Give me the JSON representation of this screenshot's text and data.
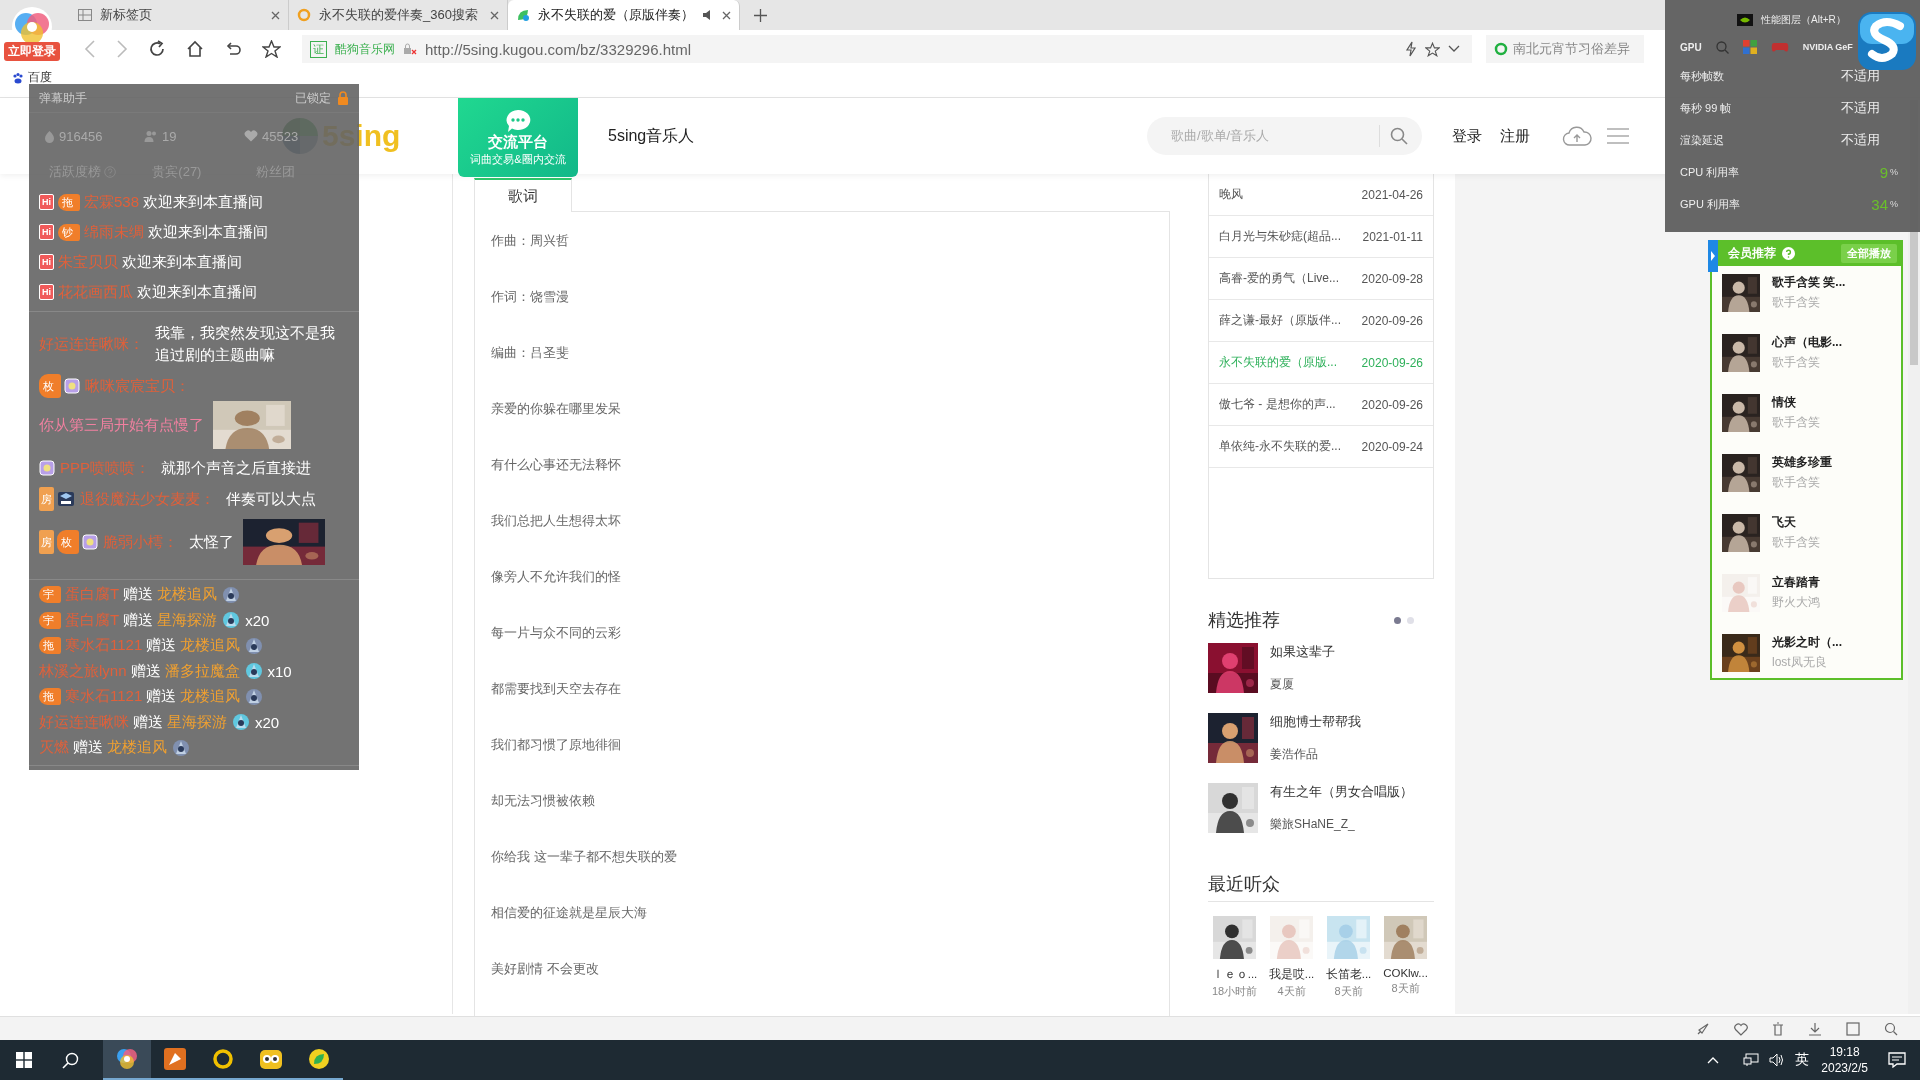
{
  "browser": {
    "tabs": [
      {
        "title": "新标签页",
        "selected": false
      },
      {
        "title": "永不失联的爱伴奏_360搜索",
        "selected": false
      },
      {
        "title": "永不失联的爱（原版伴奏）",
        "selected": true
      }
    ],
    "login_badge": "立即登录",
    "address": {
      "cert": "证",
      "site": "酷狗音乐网",
      "url": "http://5sing.kugou.com/bz/3329296.html"
    },
    "side_search": "南北元宵节习俗差异",
    "bookmarks": [
      "百度"
    ]
  },
  "header": {
    "logo": "5sing",
    "promo_title": "交流平台",
    "promo_sub": "词曲交易&圈内交流",
    "site_name": "5sing音乐人",
    "search_placeholder": "歌曲/歌单/音乐人",
    "links": [
      "登录",
      "注册"
    ]
  },
  "lyrics": {
    "tab": "歌词",
    "lines": [
      "作曲：周兴哲",
      "作词：饶雪漫",
      "编曲：吕圣斐",
      "亲爱的你躲在哪里发呆",
      "有什么心事还无法释怀",
      "我们总把人生想得太坏",
      "像旁人不允许我们的怪",
      "每一片与众不同的云彩",
      "都需要找到天空去存在",
      "我们都习惯了原地徘徊",
      "却无法习惯被依赖",
      "你给我 这一辈子都不想失联的爱",
      "相信爱的征途就是星辰大海",
      "美好剧情 不会更改"
    ]
  },
  "song_list": [
    {
      "title": "晚风",
      "date": "2021-04-26",
      "selected": false
    },
    {
      "title": "白月光与朱砂痣(超品...",
      "date": "2021-01-11",
      "selected": false
    },
    {
      "title": "高睿-爱的勇气（Live...",
      "date": "2020-09-28",
      "selected": false
    },
    {
      "title": "薛之谦-最好（原版伴...",
      "date": "2020-09-26",
      "selected": false
    },
    {
      "title": "永不失联的爱（原版...",
      "date": "2020-09-26",
      "selected": true
    },
    {
      "title": "傲七爷 - 是想你的声...",
      "date": "2020-09-26",
      "selected": false
    },
    {
      "title": "单依纯-永不失联的爱...",
      "date": "2020-09-24",
      "selected": false
    }
  ],
  "featured": {
    "title": "精选推荐",
    "pages": [
      {
        "selected": true
      },
      {
        "selected": false
      }
    ],
    "items": [
      {
        "title": "如果这辈子",
        "author": "夏厦"
      },
      {
        "title": "细胞博士帮帮我",
        "author": "姜浩作品"
      },
      {
        "title": "有生之年（男女合唱版）",
        "author": "樂旅SHaNE_Z_"
      }
    ]
  },
  "listeners": {
    "title": "最近听众",
    "items": [
      {
        "name": "ｌｅｏ...",
        "time": "18小时前"
      },
      {
        "name": "我是哎...",
        "time": "4天前"
      },
      {
        "name": "长笛老...",
        "time": "8天前"
      },
      {
        "name": "COKlw...",
        "time": "8天前"
      }
    ]
  },
  "chat_overlay": {
    "title": "弹幕助手",
    "lock": "已锁定",
    "stats": [
      {
        "kind": "heat",
        "value": "916456"
      },
      {
        "kind": "people",
        "value": "19"
      },
      {
        "kind": "likes",
        "value": "45523"
      }
    ],
    "tabs": [
      {
        "label": "活跃度榜",
        "help": true
      },
      {
        "label": "贵宾(27)",
        "help": false
      },
      {
        "label": "粉丝团",
        "help": false
      }
    ],
    "welcomes": [
      {
        "badges": [
          {
            "kind": "hi",
            "text": "Hi"
          },
          {
            "kind": "medal",
            "text": "拖"
          }
        ],
        "name": "宏霖538",
        "text": "欢迎来到本直播间"
      },
      {
        "badges": [
          {
            "kind": "hi",
            "text": "Hi"
          },
          {
            "kind": "medal",
            "text": "钞"
          }
        ],
        "name": "绵雨未绸",
        "text": "欢迎来到本直播间"
      },
      {
        "badges": [
          {
            "kind": "hi",
            "text": "Hi"
          }
        ],
        "name": "朱宝贝贝",
        "text": "欢迎来到本直播间"
      },
      {
        "badges": [
          {
            "kind": "hi",
            "text": "Hi"
          }
        ],
        "name": "花花画西瓜",
        "text": "欢迎来到本直播间"
      }
    ],
    "messages": [
      {
        "name": "好运连连啾咪：",
        "text": "我靠，我突然发现这不是我追过剧的主题曲嘛",
        "highlight": false
      },
      {
        "badges": [
          {
            "kind": "medal",
            "text": "枚"
          },
          {
            "kind": "level"
          }
        ],
        "name": "啾咪宸宸宝贝：",
        "text": "你从第三局开始有点慢了",
        "highlight": true,
        "sticker": {
          "kind": "picture"
        }
      },
      {
        "badges": [
          {
            "kind": "level"
          }
        ],
        "name": "PPP喷喷喷：",
        "text": "就那个声音之后直接进",
        "highlight": false
      },
      {
        "badges": [
          {
            "kind": "room",
            "text": "房"
          },
          {
            "kind": "crest"
          }
        ],
        "name": "退役魔法少女麦麦：",
        "text": "伴奏可以大点",
        "highlight": false
      },
      {
        "badges": [
          {
            "kind": "room",
            "text": "房"
          },
          {
            "kind": "medal",
            "text": "枚"
          },
          {
            "kind": "level"
          }
        ],
        "name": "脆弱小樗：",
        "text": "太怪了",
        "highlight": false,
        "sticker": {
          "kind": "picture"
        }
      }
    ],
    "gifts": [
      {
        "badges": [
          {
            "kind": "medal",
            "text": "宇"
          }
        ],
        "name": "蛋白腐T",
        "verb": "赠送",
        "gift": "龙楼追风"
      },
      {
        "badges": [
          {
            "kind": "medal",
            "text": "宇"
          }
        ],
        "name": "蛋白腐T",
        "verb": "赠送",
        "gift": "星海探游",
        "count": "x20"
      },
      {
        "badges": [
          {
            "kind": "medal",
            "text": "拖"
          }
        ],
        "name": "寒水石1121",
        "verb": "赠送",
        "gift": "龙楼追风"
      },
      {
        "name": "林溪之旅lynn",
        "verb": "赠送",
        "gift": "潘多拉魔盒",
        "count": "x10"
      },
      {
        "badges": [
          {
            "kind": "medal",
            "text": "拖"
          }
        ],
        "name": "寒水石1121",
        "verb": "赠送",
        "gift": "龙楼追风"
      },
      {
        "name": "好运连连啾咪",
        "verb": "赠送",
        "gift": "星海探游",
        "count": "x20"
      },
      {
        "name": "灭燃",
        "verb": "赠送",
        "gift": "龙楼追风"
      }
    ]
  },
  "perf_overlay": {
    "title": "性能图层（Alt+R）",
    "tab_label": "GPU",
    "app_label": "NVIDIA GeF",
    "metrics": [
      {
        "kind": "text",
        "label": "每秒帧数",
        "value": "不适用"
      },
      {
        "kind": "text",
        "label": "每秒 99 帧",
        "value": "不适用"
      },
      {
        "kind": "text",
        "label": "渲染延迟",
        "value": "不适用"
      },
      {
        "kind": "percent",
        "label": "CPU 利用率",
        "value": "9",
        "unit": "%"
      },
      {
        "kind": "percent",
        "label": "GPU 利用率",
        "value": "34",
        "unit": "%"
      }
    ]
  },
  "member_panel": {
    "title": "会员推荐",
    "play_all": "全部播放",
    "items": [
      {
        "title": "歌手含笑 笑...",
        "artist": "歌手含笑"
      },
      {
        "title": "心声（电影...",
        "artist": "歌手含笑"
      },
      {
        "title": "情侠",
        "artist": "歌手含笑"
      },
      {
        "title": "英雄多珍重",
        "artist": "歌手含笑"
      },
      {
        "title": "飞天",
        "artist": "歌手含笑"
      },
      {
        "title": "立春踏青",
        "artist": "野火大鸿"
      },
      {
        "title": "光影之时（...",
        "artist": "lost凤无良"
      }
    ]
  },
  "taskbar": {
    "ime": "英",
    "time": "19:18",
    "date": "2023/2/5"
  }
}
